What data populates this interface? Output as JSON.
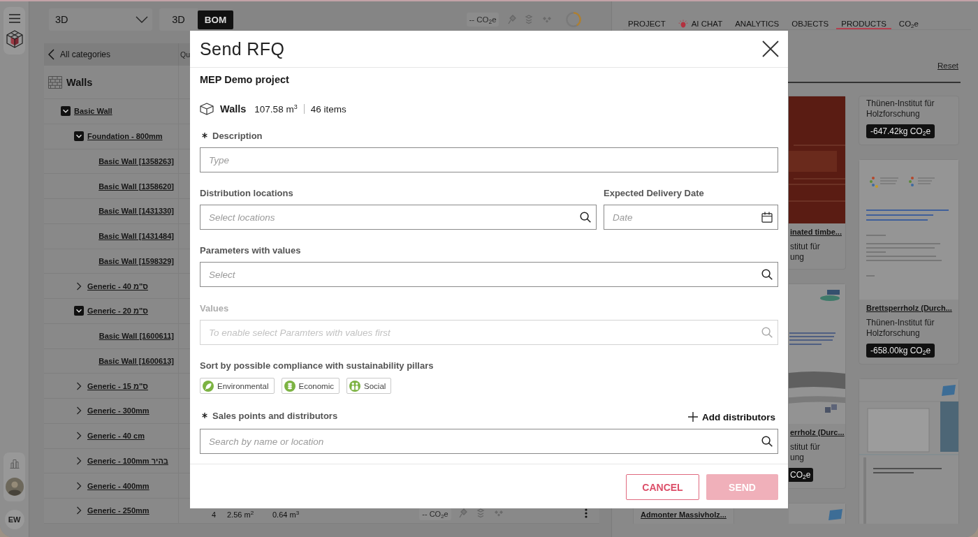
{
  "rail": {
    "user_initials": "EW"
  },
  "toolbar": {
    "view_select": "3D",
    "view_buttons": [
      {
        "label": "3D",
        "selected": false
      },
      {
        "label": "BOM",
        "selected": true
      }
    ],
    "co2_summary": "-- CO$_{2}$e"
  },
  "bom": {
    "back_label": "All categories",
    "column_header": "Qu",
    "category": "Walls",
    "tree": [
      {
        "kind": "group",
        "label": "Basic Wall",
        "expanded": true,
        "children": [
          {
            "kind": "group",
            "label": "Foundation - 800mm",
            "expanded": true,
            "children": [
              {
                "kind": "item",
                "label": "Basic Wall [1358263]"
              },
              {
                "kind": "item",
                "label": "Basic Wall [1358620]"
              },
              {
                "kind": "item",
                "label": "Basic Wall [1431330]"
              },
              {
                "kind": "item",
                "label": "Basic Wall [1431484]"
              },
              {
                "kind": "item",
                "label": "Basic Wall [1598329]"
              }
            ]
          },
          {
            "kind": "group",
            "label": "Generic - 40 ס\"מ",
            "expanded": false
          },
          {
            "kind": "group",
            "label": "Generic - 20 ס\"מ",
            "expanded": true,
            "children": [
              {
                "kind": "item",
                "label": "Basic Wall [1600611]"
              },
              {
                "kind": "item",
                "label": "Basic Wall [1600613]"
              }
            ]
          },
          {
            "kind": "group",
            "label": "Generic - 15 ס\"מ",
            "expanded": false
          },
          {
            "kind": "group",
            "label": "Generic - 300mm",
            "expanded": false
          },
          {
            "kind": "group",
            "label": "Generic - 40 cm",
            "expanded": false
          },
          {
            "kind": "group",
            "label": "Generic - 100mm בהיר",
            "expanded": false
          },
          {
            "kind": "group",
            "label": "Generic - 400mm",
            "expanded": false
          },
          {
            "kind": "group",
            "label": "Generic - 250mm",
            "expanded": false,
            "cells": [
              "4",
              "2.56 m$^{2}$",
              "0.64 m$^{3}$"
            ],
            "co2": "-- CO$_{2}$e"
          }
        ]
      }
    ]
  },
  "products": {
    "tabs": [
      {
        "label": "PROJECT",
        "kind": "plain",
        "selected": false
      },
      {
        "label": "AI CHAT",
        "kind": "ai",
        "selected": false
      },
      {
        "label": "ANALYTICS",
        "kind": "plain",
        "selected": false
      },
      {
        "label": "OBJECTS",
        "kind": "plain",
        "selected": false
      },
      {
        "label": "PRODUCTS",
        "kind": "plain",
        "selected": true
      },
      {
        "label": "CO$_{2}$e",
        "kind": "plain",
        "selected": false
      }
    ],
    "reset": "Reset",
    "columns": [
      {
        "cards": [
          {
            "kind": "text",
            "title": "Admonter Massivholz..."
          }
        ]
      },
      {
        "cards": [
          {
            "kind": "book",
            "title": "inated timbe...",
            "lines": [
              "stitut für",
              "ung"
            ]
          },
          {
            "kind": "report",
            "title": "errholz (Durc...",
            "lines": [
              "stitut für",
              "ung"
            ],
            "badge": "CO$_{2}$e"
          },
          {
            "kind": "brochure"
          }
        ]
      },
      {
        "cards": [
          {
            "kind": "text",
            "lines": [
              "Thünen-Institut für",
              "Holzforschung"
            ],
            "badge": "-647.42kg CO$_{2}$e"
          },
          {
            "kind": "document",
            "title": "Brettsperrholz (Durch...",
            "lines": [
              "Thünen-Institut für",
              "Holzforschung"
            ],
            "badge": "-658.00kg CO$_{2}$e"
          },
          {
            "kind": "brochure"
          }
        ]
      }
    ]
  },
  "dialog": {
    "title": "Send RFQ",
    "project": "MEP Demo project",
    "summary": {
      "category": "Walls",
      "volume": "107.58 m$^{3}$",
      "count": "46 items"
    },
    "form_rows": [
      {
        "fields": [
          {
            "kind": "text",
            "label": "Description",
            "required": true,
            "disabled": false,
            "placeholder": "Type"
          }
        ]
      },
      {
        "fields": [
          {
            "kind": "search",
            "label": "Distribution locations",
            "required": false,
            "disabled": false,
            "placeholder": "Select locations"
          },
          {
            "kind": "date",
            "label": "Expected Delivery Date",
            "required": false,
            "disabled": false,
            "placeholder": "Date"
          }
        ]
      },
      {
        "fields": [
          {
            "kind": "search",
            "label": "Parameters with values",
            "required": false,
            "disabled": false,
            "placeholder": "Select"
          }
        ]
      },
      {
        "fields": [
          {
            "kind": "search",
            "label": "Values",
            "required": false,
            "disabled": true,
            "placeholder": "To enable select Paramters with values first"
          }
        ]
      }
    ],
    "pillars": {
      "label": "Sort by possible compliance with sustainability pillars",
      "options": [
        {
          "kind": "environmental",
          "label": "Environmental",
          "selected": false
        },
        {
          "kind": "economic",
          "label": "Economic",
          "selected": false
        },
        {
          "kind": "social",
          "label": "Social",
          "selected": false
        }
      ]
    },
    "distributors": {
      "label": "Sales points and distributors",
      "required": true,
      "action": "Add distributors",
      "placeholder": "Search by name or location"
    },
    "buttons": [
      {
        "kind": "secondary",
        "label": "CANCEL",
        "disabled": false
      },
      {
        "kind": "primary",
        "label": "SEND",
        "disabled": true
      }
    ]
  }
}
